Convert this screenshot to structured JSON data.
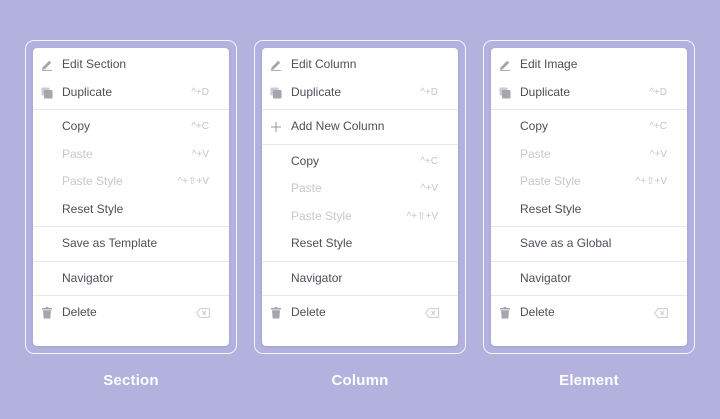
{
  "panels": [
    {
      "caption": "Section",
      "edit": "Edit Section",
      "duplicate": "Duplicate",
      "duplicate_sc": "^+D",
      "copy": "Copy",
      "copy_sc": "^+C",
      "paste": "Paste",
      "paste_sc": "^+V",
      "paste_style": "Paste Style",
      "paste_style_sc": "^+⇧+V",
      "reset_style": "Reset Style",
      "save": "Save as Template",
      "navigator": "Navigator",
      "delete": "Delete"
    },
    {
      "caption": "Column",
      "edit": "Edit Column",
      "duplicate": "Duplicate",
      "duplicate_sc": "^+D",
      "add_column": "Add New Column",
      "copy": "Copy",
      "copy_sc": "^+C",
      "paste": "Paste",
      "paste_sc": "^+V",
      "paste_style": "Paste Style",
      "paste_style_sc": "^+⇧+V",
      "reset_style": "Reset Style",
      "navigator": "Navigator",
      "delete": "Delete"
    },
    {
      "caption": "Element",
      "edit": "Edit Image",
      "duplicate": "Duplicate",
      "duplicate_sc": "^+D",
      "copy": "Copy",
      "copy_sc": "^+C",
      "paste": "Paste",
      "paste_sc": "^+V",
      "paste_style": "Paste Style",
      "paste_style_sc": "^+⇧+V",
      "reset_style": "Reset Style",
      "save": "Save as a Global",
      "navigator": "Navigator",
      "delete": "Delete"
    }
  ],
  "colors": {
    "background": "#b3b2df",
    "text": "#4d4f57",
    "disabled_text": "#c6c8cf",
    "shortcut": "#c3c5cc",
    "icon": "#a4a6ae"
  },
  "icons": {
    "edit": "pencil-icon",
    "duplicate": "duplicate-icon",
    "add": "plus-icon",
    "delete": "trash-icon",
    "delete_shortcut": "backspace-key-icon"
  }
}
